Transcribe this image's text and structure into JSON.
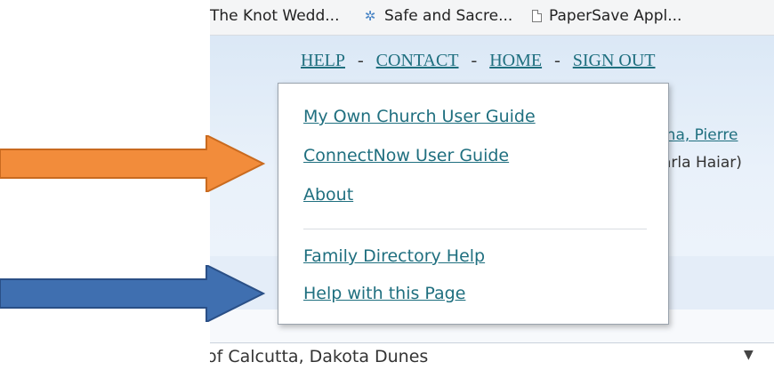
{
  "bookmarks": [
    {
      "label": "The Knot Wedd...",
      "icon": "none"
    },
    {
      "label": "Safe and Sacre...",
      "icon": "star-icon"
    },
    {
      "label": "PaperSave Appl...",
      "icon": "page-icon"
    }
  ],
  "topnav": {
    "help": "HELP",
    "contact": "CONTACT",
    "home": "HOME",
    "sign_out": "SIGN OUT",
    "separator": "-"
  },
  "background": {
    "name_link": "tha, Pierre",
    "name_text": "arla Haiar)"
  },
  "help_menu": {
    "items": [
      "My Own Church User Guide",
      "ConnectNow User Guide",
      "About",
      "Family Directory Help",
      "Help with this Page"
    ]
  },
  "location_select": {
    "value": "of Calcutta, Dakota Dunes",
    "arrow": "▼"
  },
  "colors": {
    "link": "#1f6f7f",
    "orange_arrow": "#f28c3b",
    "blue_arrow": "#3f6fb0"
  }
}
